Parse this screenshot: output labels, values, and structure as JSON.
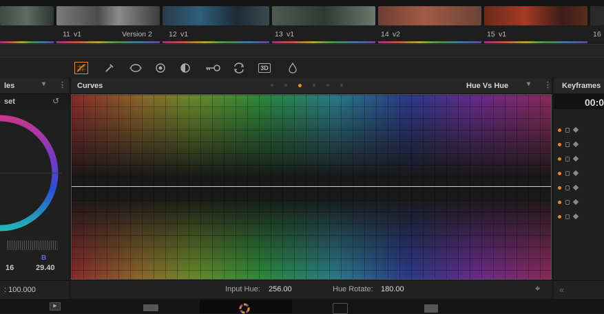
{
  "timeline": {
    "clips": [
      {
        "num": "11",
        "version": "v1",
        "name": "Version 2"
      },
      {
        "num": "12",
        "version": "v1"
      },
      {
        "num": "13",
        "version": "v1"
      },
      {
        "num": "14",
        "version": "v2"
      },
      {
        "num": "15",
        "version": "v1"
      },
      {
        "num": "16"
      }
    ]
  },
  "toolbar": {
    "tools": [
      "curves-icon",
      "qualifier-picker-icon",
      "power-window-icon",
      "tracker-icon",
      "blur-icon",
      "key-icon",
      "resize-icon",
      "3d-icon",
      "stereo-icon"
    ],
    "label_3d": "3D"
  },
  "left_panel": {
    "title_fragment": "les",
    "subtitle_fragment": "set",
    "channel_label": "B",
    "left_value": "16",
    "b_value": "29.40",
    "footer_value": ": 100.000"
  },
  "curves_panel": {
    "title": "Curves",
    "mode": "Hue Vs Hue",
    "input_hue_label": "Input Hue:",
    "input_hue_value": "256.00",
    "hue_rotate_label": "Hue Rotate:",
    "hue_rotate_value": "180.00"
  },
  "keyframes_panel": {
    "title": "Keyframes",
    "timecode": "00:0",
    "row_count": 7
  },
  "colors": {
    "accent": "#e58a2a",
    "panel_bg": "#1f1f1f"
  }
}
